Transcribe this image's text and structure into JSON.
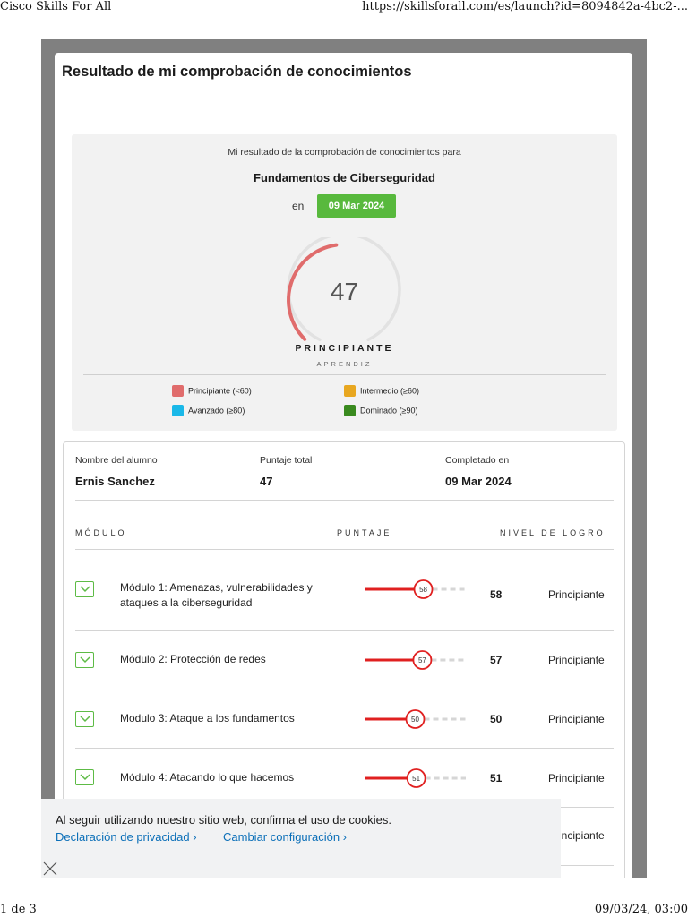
{
  "print": {
    "title": "Cisco Skills For All",
    "url": "https://skillsforall.com/es/launch?id=8094842a-4bc2-...",
    "page": "1 de 3",
    "datetime": "09/03/24, 03:00"
  },
  "page_title": "Resultado de mi comprobación de conocimientos",
  "summary": {
    "intro": "Mi resultado de la comprobación de conocimientos para",
    "course": "Fundamentos de Ciberseguridad",
    "en_label": "en",
    "date": "09 Mar 2024",
    "score": "47",
    "score_fraction": 0.47,
    "level": "PRINCIPIANTE",
    "level_sub": "APRENDIZ",
    "legend": [
      {
        "label": "Principiante (<60)",
        "color": "#e06c6c"
      },
      {
        "label": "Intermedio (≥60)",
        "color": "#e8a720"
      },
      {
        "label": "Avanzado (≥80)",
        "color": "#1ab8e8"
      },
      {
        "label": "Dominado (≥90)",
        "color": "#3a8a1f"
      }
    ]
  },
  "details": {
    "student_label": "Nombre del alumno",
    "student_value": "Ernis Sanchez",
    "total_label": "Puntaje total",
    "total_value": "47",
    "completed_label": "Completado en",
    "completed_value": "09 Mar 2024",
    "col_module": "MÓDULO",
    "col_score": "PUNTAJE",
    "col_level": "NIVEL DE LOGRO",
    "modules": [
      {
        "name": "Módulo 1: Amenazas, vulnerabilidades y ataques a la ciberseguridad",
        "score": "58",
        "level": "Principiante"
      },
      {
        "name": "Módulo 2: Protección de redes",
        "score": "57",
        "level": "Principiante"
      },
      {
        "name": "Modulo 3: Ataque a los fundamentos",
        "score": "50",
        "level": "Principiante"
      },
      {
        "name": "Módulo 4: Atacando lo que hacemos",
        "score": "51",
        "level": "Principiante"
      },
      {
        "name": "",
        "score": "",
        "level": "Principiante"
      }
    ]
  },
  "cookie": {
    "message": "Al seguir utilizando nuestro sitio web, confirma el uso de cookies.",
    "privacy_link": "Declaración de privacidad ›",
    "settings_link": "Cambiar configuración ›"
  },
  "colors": {
    "gauge_fill": "#e06c6c",
    "gauge_track": "#e2e2e2",
    "bar_fill": "#e02020",
    "bar_track": "#d6d6d6",
    "accent_green": "#58b93d"
  }
}
